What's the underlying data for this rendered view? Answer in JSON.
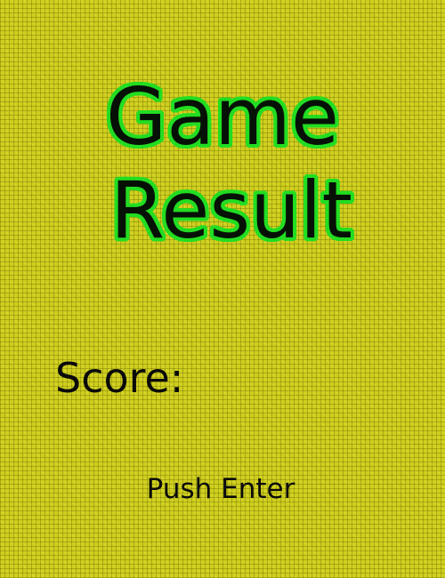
{
  "title": {
    "line1": "Game",
    "line2": "Result"
  },
  "score": {
    "label": "Score:",
    "value": ""
  },
  "prompt": "Push Enter",
  "colors": {
    "background": "#cfcf1e",
    "title_fill": "#061106",
    "title_outline": "#22dd22",
    "text": "#0a0a0a"
  }
}
